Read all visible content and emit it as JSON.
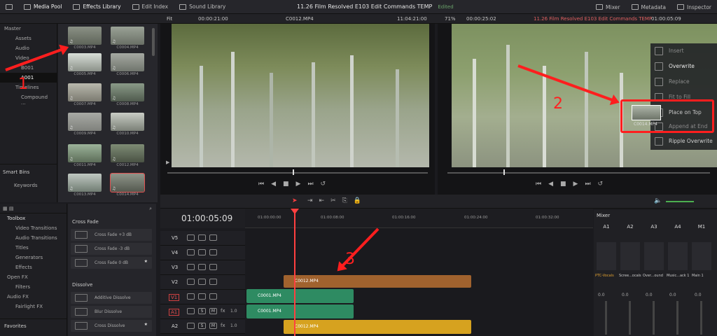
{
  "topbar": {
    "media_pool": "Media Pool",
    "effects_library": "Effects Library",
    "edit_index": "Edit Index",
    "sound_library": "Sound Library",
    "project_title": "11.26 Film Resolved E103 Edit Commands TEMP",
    "edited": "Edited",
    "mixer": "Mixer",
    "metadata": "Metadata",
    "inspector": "Inspector"
  },
  "source_viewer": {
    "fit": "Fit",
    "duration": "00:00:21:00",
    "clip": "C0012.MP4",
    "timecode": "11:04:21:00"
  },
  "timeline_viewer": {
    "zoom": "71%",
    "duration": "00:00:25:02",
    "title": "11.26 Film Resolved E103 Edit Commands TEMP",
    "timecode": "01:00:05:09"
  },
  "bins": {
    "master": "Master",
    "items": [
      "Assets",
      "Audio",
      "Video",
      "B001",
      "A001",
      "Timelines",
      "Compound ..."
    ],
    "smart_bins": "Smart Bins",
    "keywords": "Keywords"
  },
  "clips": [
    "C0003.MP4",
    "C0004.MP4",
    "C0005.MP4",
    "C0006.MP4",
    "C0007.MP4",
    "C0008.MP4",
    "C0009.MP4",
    "C0010.MP4",
    "C0011.MP4",
    "C0012.MP4",
    "C0013.MP4",
    "C0014.MP4"
  ],
  "menu": {
    "items": [
      "Insert",
      "Overwrite",
      "Replace",
      "Fit to Fill",
      "Place on Top",
      "Append at End",
      "Ripple Overwrite"
    ],
    "drag_clip": "C0014.MP4"
  },
  "toolbox": {
    "title": "Toolbox",
    "items": [
      "Video Transitions",
      "Audio Transitions",
      "Titles",
      "Generators",
      "Effects"
    ],
    "open_fx": "Open FX",
    "filters": "Filters",
    "audio_fx": "Audio FX",
    "fairlight_fx": "Fairlight FX",
    "favorites": "Favorites"
  },
  "effects": {
    "cross_fade": "Cross Fade",
    "cf_items": [
      "Cross Fade +3 dB",
      "Cross Fade -3 dB",
      "Cross Fade 0 dB"
    ],
    "dissolve": "Dissolve",
    "d_items": [
      "Additive Dissolve",
      "Blur Dissolve",
      "Cross Dissolve"
    ]
  },
  "timeline": {
    "timecode": "01:00:05:09",
    "ruler": [
      "01:00:00:00",
      "01:00:08:00",
      "01:00:16:00",
      "01:00:24:00",
      "01:00:32:00"
    ],
    "tracks": [
      "V5",
      "V4",
      "V3",
      "V2",
      "V1",
      "A1",
      "A2"
    ],
    "fx_value": "1.0",
    "clips": {
      "v2": "C0012.MP4",
      "v1": "C0001.MP4",
      "a1": "C0001.MP4",
      "a2": "C0012.MP4"
    }
  },
  "mixer": {
    "title": "Mixer",
    "channels": [
      "A1",
      "A2",
      "A3",
      "A4",
      "M1"
    ],
    "names": [
      "PTC-Vocals",
      "Scree...ocals",
      "Over...ound",
      "Music...ack 1",
      "Main 1"
    ],
    "db": "0.0"
  },
  "annotations": [
    "1",
    "2",
    "3"
  ]
}
